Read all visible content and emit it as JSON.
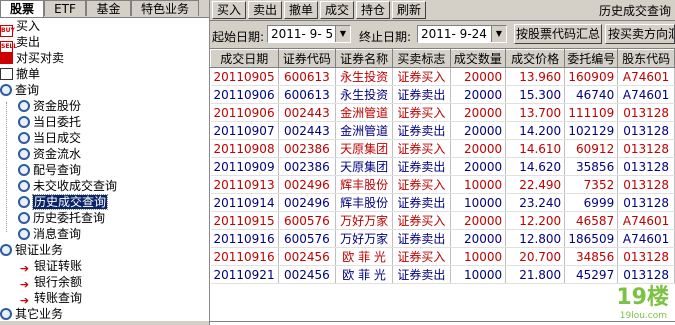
{
  "tabs": [
    "股票",
    "ETF",
    "基金",
    "特色业务"
  ],
  "tree": [
    {
      "label": "买入",
      "icon": "buy-icon",
      "level": 0
    },
    {
      "label": "卖出",
      "icon": "sell-icon",
      "level": 0
    },
    {
      "label": "对买对卖",
      "icon": "trade-icon",
      "level": 0
    },
    {
      "label": "撤单",
      "icon": "cancel-icon",
      "level": 0
    },
    {
      "label": "查询",
      "icon": "search-icon",
      "level": 0
    },
    {
      "label": "资金股份",
      "icon": "query-icon",
      "level": 1
    },
    {
      "label": "当日委托",
      "icon": "query-icon",
      "level": 1
    },
    {
      "label": "当日成交",
      "icon": "query-icon",
      "level": 1
    },
    {
      "label": "资金流水",
      "icon": "query-icon",
      "level": 1
    },
    {
      "label": "配号查询",
      "icon": "query-icon",
      "level": 1
    },
    {
      "label": "未交收成交查询",
      "icon": "query-icon",
      "level": 1
    },
    {
      "label": "历史成交查询",
      "icon": "query-icon",
      "level": 1,
      "selected": true
    },
    {
      "label": "历史委托查询",
      "icon": "query-icon",
      "level": 1
    },
    {
      "label": "消息查询",
      "icon": "query-icon",
      "level": 1
    },
    {
      "label": "银证业务",
      "icon": "search-icon",
      "level": 0
    },
    {
      "label": "银证转账",
      "icon": "arrow-icon",
      "level": 1
    },
    {
      "label": "银行余额",
      "icon": "arrow-icon",
      "level": 1
    },
    {
      "label": "转账查询",
      "icon": "arrow-icon",
      "level": 1
    },
    {
      "label": "其它业务",
      "icon": "search-icon",
      "level": 0
    }
  ],
  "toolbar": {
    "buttons": [
      "买入",
      "卖出",
      "撤单",
      "成交",
      "持仓",
      "刷新"
    ],
    "page_title": "历史成交查询"
  },
  "filter": {
    "start_label": "起始日期:",
    "start_date": "2011- 9- 5",
    "end_label": "终止日期:",
    "end_date": "2011- 9-24",
    "btn_summary": "按股票代码汇总",
    "btn_direction": "按买卖方向汇总"
  },
  "table": {
    "columns": [
      "成交日期",
      "证券代码",
      "证券名称",
      "买卖标志",
      "成交数量",
      "成交价格",
      "委托编号",
      "股东代码"
    ],
    "rows": [
      [
        "20110905",
        "600613",
        "永生投资",
        "证券买入",
        "20000",
        "13.960",
        "160909",
        "A74601",
        "buy"
      ],
      [
        "20110906",
        "600613",
        "永生投资",
        "证券卖出",
        "20000",
        "15.300",
        "46740",
        "A74601",
        "sell"
      ],
      [
        "20110906",
        "002443",
        "金洲管道",
        "证券买入",
        "20000",
        "13.700",
        "111109",
        "013128",
        "buy"
      ],
      [
        "20110907",
        "002443",
        "金洲管道",
        "证券卖出",
        "20000",
        "14.200",
        "102129",
        "013128",
        "sell"
      ],
      [
        "20110908",
        "002386",
        "天原集团",
        "证券买入",
        "20000",
        "14.610",
        "60912",
        "013128",
        "buy"
      ],
      [
        "20110909",
        "002386",
        "天原集团",
        "证券卖出",
        "20000",
        "14.620",
        "35856",
        "013128",
        "sell"
      ],
      [
        "20110913",
        "002496",
        "辉丰股份",
        "证券买入",
        "10000",
        "22.490",
        "7352",
        "013128",
        "buy"
      ],
      [
        "20110914",
        "002496",
        "辉丰股份",
        "证券卖出",
        "10000",
        "23.240",
        "6999",
        "013128",
        "sell"
      ],
      [
        "20110915",
        "600576",
        "万好万家",
        "证券买入",
        "20000",
        "12.200",
        "46587",
        "A74601",
        "buy"
      ],
      [
        "20110916",
        "600576",
        "万好万家",
        "证券卖出",
        "20000",
        "12.800",
        "186509",
        "A74601",
        "sell"
      ],
      [
        "20110916",
        "002456",
        "欧 菲 光",
        "证券买入",
        "10000",
        "20.700",
        "34856",
        "013128",
        "buy"
      ],
      [
        "20110921",
        "002456",
        "欧 菲 光",
        "证券卖出",
        "10000",
        "21.800",
        "45297",
        "013128",
        "sell"
      ]
    ]
  },
  "watermark": {
    "main": "19楼",
    "sub": "19lou.com"
  },
  "colors": {
    "buy": "#c00000",
    "sell": "#000080",
    "selected_bg": "#0a246a",
    "chrome": "#d4d0c8"
  }
}
